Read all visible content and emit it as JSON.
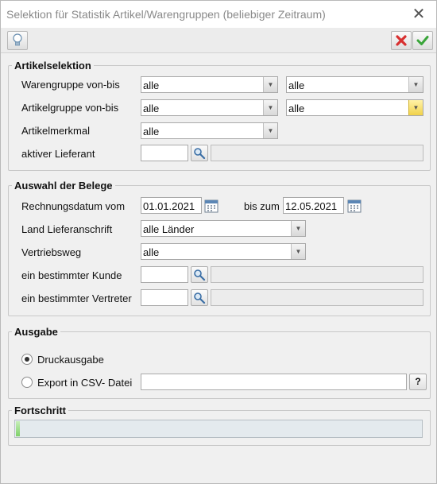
{
  "window": {
    "title": "Selektion für Statistik Artikel/Warengruppen (beliebiger Zeitraum)"
  },
  "icons": {
    "hint": "lightbulb-icon",
    "cancel": "red-x-icon",
    "ok": "green-check-icon",
    "search": "magnifier-icon",
    "calendar": "calendar-icon",
    "dropdown": "chevron-down-icon",
    "help": "?"
  },
  "artikel": {
    "legend": "Artikelselektion",
    "warengruppe_label": "Warengruppe von-bis",
    "warengruppe_von": "alle",
    "warengruppe_bis": "alle",
    "artikelgruppe_label": "Artikelgruppe von-bis",
    "artikelgruppe_von": "alle",
    "artikelgruppe_bis": "alle",
    "merkmal_label": "Artikelmerkmal",
    "merkmal_value": "alle",
    "lieferant_label": "aktiver Lieferant",
    "lieferant_value": "",
    "lieferant_name": ""
  },
  "belege": {
    "legend": "Auswahl der Belege",
    "rdatum_label": "Rechnungsdatum vom",
    "rdatum_von": "01.01.2021",
    "bis_label": "bis zum",
    "rdatum_bis": "12.05.2021",
    "land_label": "Land Lieferanschrift",
    "land_value": "alle Länder",
    "vertrieb_label": "Vertriebsweg",
    "vertrieb_value": "alle",
    "kunde_label": "ein bestimmter Kunde",
    "kunde_value": "",
    "kunde_name": "",
    "vertreter_label": "ein bestimmter Vertreter",
    "vertreter_value": "",
    "vertreter_name": ""
  },
  "ausgabe": {
    "legend": "Ausgabe",
    "druck_label": "Druckausgabe",
    "druck_selected": true,
    "csv_label": "Export in CSV- Datei",
    "csv_selected": false,
    "csv_path": ""
  },
  "fortschritt": {
    "legend": "Fortschritt",
    "progress": 0.01
  },
  "colors": {
    "accent_green": "#7fd06a",
    "cancel_red": "#d83030",
    "ok_green": "#3aa53a"
  }
}
